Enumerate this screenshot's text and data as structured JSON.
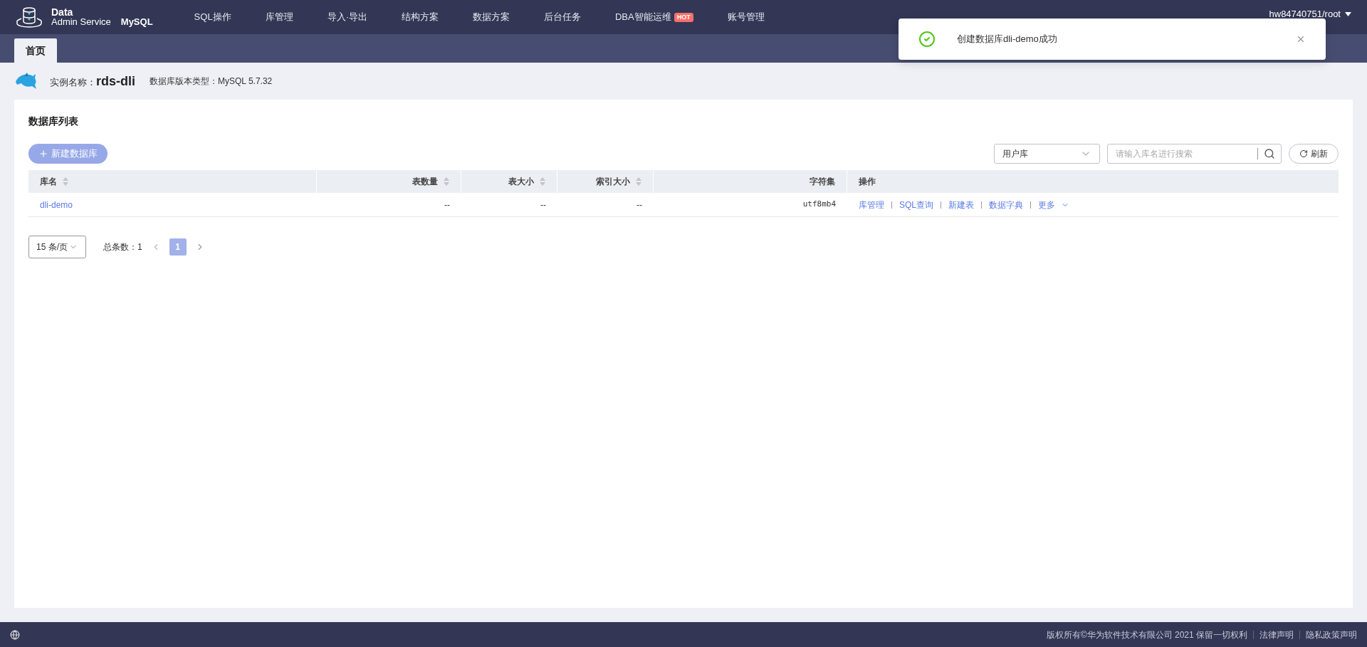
{
  "header": {
    "logo_line1": "Data",
    "logo_line2": "Admin Service",
    "engine": "MySQL",
    "nav": [
      {
        "label": "SQL操作"
      },
      {
        "label": "库管理"
      },
      {
        "label": "导入·导出"
      },
      {
        "label": "结构方案"
      },
      {
        "label": "数据方案"
      },
      {
        "label": "后台任务"
      },
      {
        "label": "DBA智能运维",
        "badge": "HOT"
      },
      {
        "label": "账号管理"
      }
    ],
    "user": "hw84740751/root"
  },
  "tabs": [
    {
      "label": "首页",
      "selected": true
    }
  ],
  "instance": {
    "name_label": "实例名称：",
    "name": "rds-dli",
    "version": "数据库版本类型：MySQL 5.7.32"
  },
  "card": {
    "title": "数据库列表",
    "create_button": "新建数据库",
    "filter": {
      "value": "用户库"
    },
    "search": {
      "placeholder": "请输入库名进行搜索"
    },
    "refresh_button": "刷新",
    "table": {
      "columns": [
        {
          "label": "库名",
          "sortable": true
        },
        {
          "label": "表数量",
          "sortable": true
        },
        {
          "label": "表大小",
          "sortable": true
        },
        {
          "label": "索引大小",
          "sortable": true
        },
        {
          "label": "字符集",
          "sortable": false
        },
        {
          "label": "操作",
          "sortable": false
        }
      ],
      "rows": [
        {
          "name": "dli-demo",
          "tables": "--",
          "size": "--",
          "index_size": "--",
          "charset": "utf8mb4",
          "actions": [
            "库管理",
            "SQL查询",
            "新建表",
            "数据字典",
            "更多"
          ]
        }
      ]
    },
    "pagination": {
      "page_size": "15 条/页",
      "total": "总条数：1",
      "pages": [
        {
          "label": "1",
          "selected": true
        }
      ]
    }
  },
  "toast": {
    "message": "创建数据库dli-demo成功"
  },
  "footer": {
    "copyright": "版权所有©华为软件技术有限公司 2021 保留一切权利",
    "links": [
      "法律声明",
      "隐私政策声明"
    ]
  }
}
